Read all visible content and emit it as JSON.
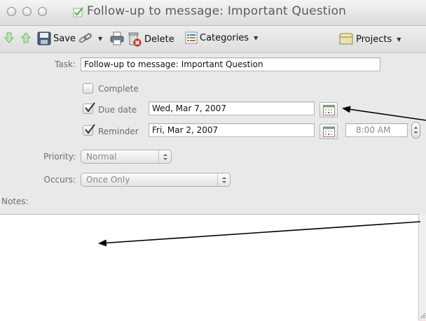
{
  "window": {
    "title": "Follow-up to message: Important Question",
    "title_icon": "task-checkbox-icon"
  },
  "toolbar": {
    "save_label": "Save",
    "delete_label": "Delete",
    "categories_label": "Categories",
    "projects_label": "Projects",
    "icons": [
      "down-arrow-icon",
      "up-arrow-icon",
      "save-disk-icon",
      "link-chain-icon",
      "printer-icon",
      "delete-trash-icon",
      "categories-icon",
      "projects-folder-icon"
    ]
  },
  "form": {
    "task_label": "Task:",
    "task_value": "Follow-up to message: Important Question",
    "complete_label": "Complete",
    "complete_checked": false,
    "due_label": "Due date",
    "due_checked": true,
    "due_value": "Wed, Mar 7, 2007",
    "reminder_label": "Reminder",
    "reminder_checked": true,
    "reminder_date": "Fri, Mar 2, 2007",
    "reminder_time": "8:00 AM",
    "priority_label": "Priority:",
    "priority_value": "Normal",
    "occurs_label": "Occurs:",
    "occurs_value": "Once Only",
    "notes_label": "Notes:",
    "notes_value": ""
  },
  "colors": {
    "background_outside": "#f7dede",
    "window": "#e9e9e9",
    "annotation_arrow": "#000000",
    "green_arrow": "#7cc477"
  }
}
